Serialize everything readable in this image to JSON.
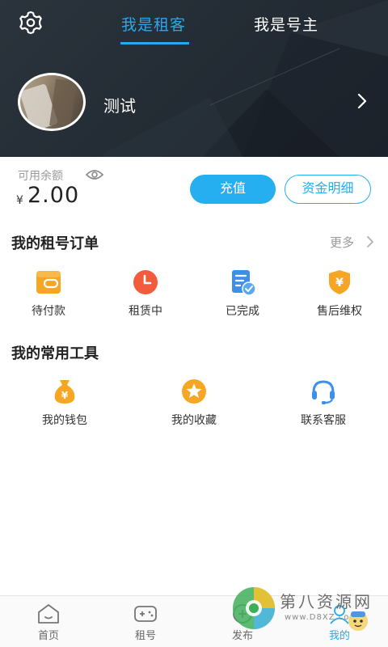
{
  "header": {
    "tabs": [
      {
        "label": "我是租客",
        "active": true
      },
      {
        "label": "我是号主",
        "active": false
      }
    ],
    "user": {
      "name": "测试"
    }
  },
  "balance": {
    "label": "可用余额",
    "currency": "¥",
    "value": "2.00",
    "recharge_label": "充值",
    "details_label": "资金明细"
  },
  "orders": {
    "title": "我的租号订单",
    "more_label": "更多",
    "items": [
      {
        "label": "待付款",
        "icon": "wallet-icon"
      },
      {
        "label": "租赁中",
        "icon": "clock-icon"
      },
      {
        "label": "已完成",
        "icon": "checklist-icon"
      },
      {
        "label": "售后维权",
        "icon": "shield-yen-icon"
      }
    ]
  },
  "tools": {
    "title": "我的常用工具",
    "items": [
      {
        "label": "我的钱包",
        "icon": "money-bag-icon"
      },
      {
        "label": "我的收藏",
        "icon": "star-icon"
      },
      {
        "label": "联系客服",
        "icon": "headset-icon"
      }
    ]
  },
  "bottom_nav": {
    "items": [
      {
        "label": "首页",
        "icon": "home-icon",
        "active": false
      },
      {
        "label": "租号",
        "icon": "gamepad-icon",
        "active": false
      },
      {
        "label": "发布",
        "icon": "publish-icon",
        "active": false
      },
      {
        "label": "我的",
        "icon": "profile-icon",
        "active": true
      }
    ]
  },
  "watermark": {
    "name": "第八资源网",
    "url": "www.D8XZ.com"
  },
  "colors": {
    "accent": "#25a9ee",
    "header_bg": "#262e37",
    "orange": "#f6a623",
    "red": "#f25b3c",
    "blue": "#3d8fe8"
  }
}
